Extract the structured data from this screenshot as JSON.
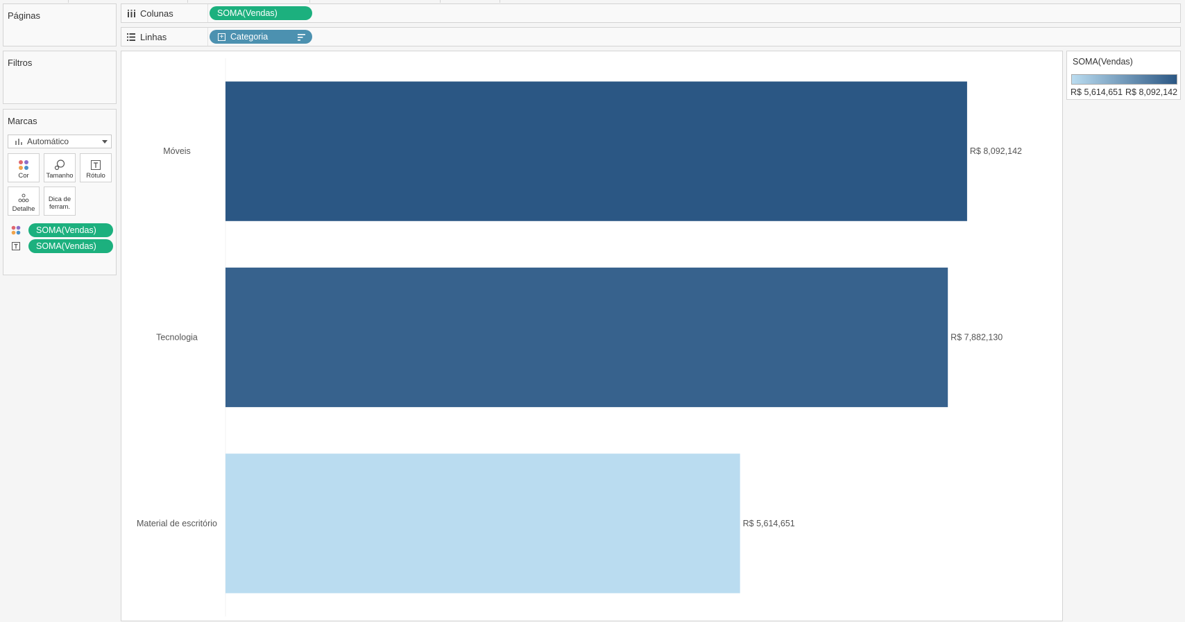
{
  "colors": {
    "accent_green": "#1cb07e",
    "accent_blue": "#4c91b0",
    "bar_dark": "#2b5784",
    "bar_light": "#badcf0"
  },
  "cards": {
    "pages_title": "Páginas",
    "filters_title": "Filtros",
    "marks_title": "Marcas"
  },
  "shelves": {
    "columns": {
      "label": "Colunas",
      "pill": "SOMA(Vendas)"
    },
    "rows": {
      "label": "Linhas",
      "pill": "Categoria"
    }
  },
  "marks": {
    "type_selected": "Automático",
    "buttons": {
      "color": "Cor",
      "size": "Tamanho",
      "label": "Rótulo",
      "detail": "Detalhe",
      "tooltip_line1": "Dica de",
      "tooltip_line2": "ferram."
    },
    "fields": [
      {
        "role": "color",
        "icon": "color-dots-icon",
        "pill": "SOMA(Vendas)"
      },
      {
        "role": "label",
        "icon": "text-label-icon",
        "pill": "SOMA(Vendas)"
      }
    ]
  },
  "legend": {
    "title": "SOMA(Vendas)",
    "min_label": "R$ 5,614,651",
    "max_label": "R$ 8,092,142"
  },
  "chart_data": {
    "type": "bar",
    "orientation": "horizontal",
    "categories": [
      "Móveis",
      "Tecnologia",
      "Material de escritório"
    ],
    "values": [
      8092142,
      7882130,
      5614651
    ],
    "value_labels": [
      "R$ 8,092,142",
      "R$ 7,882,130",
      "R$ 5,614,651"
    ],
    "xlim": [
      0,
      8600000
    ],
    "color_range": [
      5614651,
      8092142
    ],
    "grid": false
  }
}
